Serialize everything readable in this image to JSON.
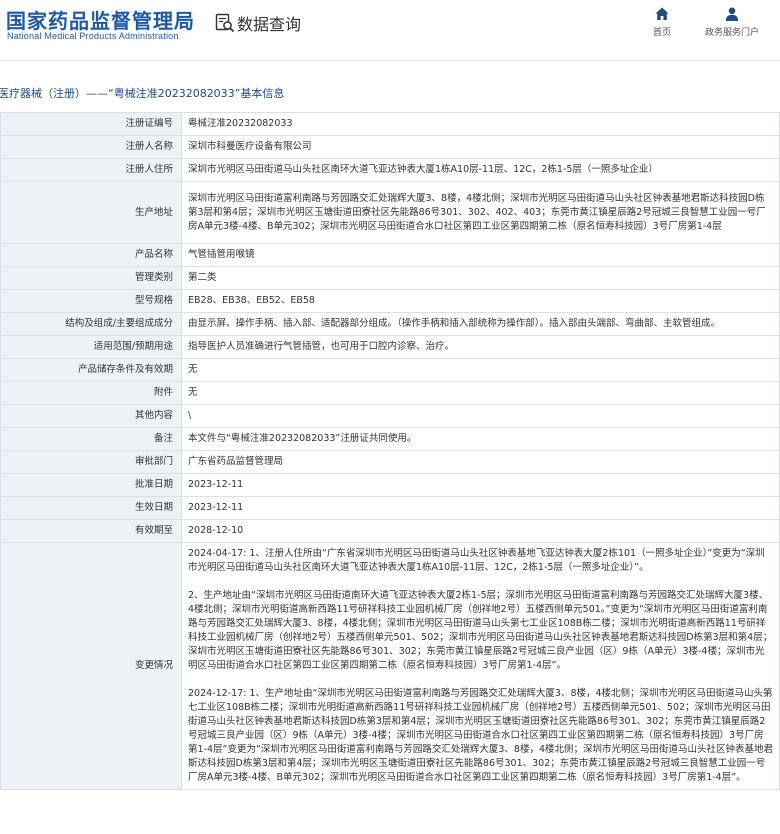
{
  "header": {
    "logo_cn": "国家药品监督管理局",
    "logo_en": "National Medical Products Administration",
    "section_title": "数据查询",
    "nav": [
      {
        "label": "首页",
        "icon": "home-icon"
      },
      {
        "label": "政务服务门户",
        "icon": "user-icon"
      }
    ]
  },
  "breadcrumb": "医疗器械（注册）——“粤械注准20232082033”基本信息",
  "rows": [
    {
      "key": "注册证编号",
      "value": "粤械注准20232082033"
    },
    {
      "key": "注册人名称",
      "value": "深圳市科曼医疗设备有限公司"
    },
    {
      "key": "注册人住所",
      "value": "深圳市光明区马田街道马山头社区南环大道飞亚达钟表大厦1栋A10层-11层、12C，2栋1-5层（一照多址企业）"
    },
    {
      "key": "生产地址",
      "value": "深圳市光明区马田街道富利南路与芳园路交汇处瑞辉大厦3、8楼，4楼北侧；深圳市光明区马田街道马山头社区钟表基地君斯达科技园D栋第3层和第4层；深圳市光明区玉塘街道田寮社区先能路86号301、302、402、403；东莞市黄江镇星辰路2号冠城三良智慧工业园一号厂房A单元3楼-4楼、B单元302；深圳市光明区马田街道合水口社区第四工业区第四期第二栋（原名恒寿科技园）3号厂房第1-4层"
    },
    {
      "key": "产品名称",
      "value": "气管插管用喉镜"
    },
    {
      "key": "管理类别",
      "value": "第二类"
    },
    {
      "key": "型号规格",
      "value": "EB28、EB38、EB52、EB58"
    },
    {
      "key": "结构及组成/主要组成成分",
      "value": "由显示屏、操作手柄、插入部、适配器部分组成。（操作手柄和插入部统称为操作部）。插入部由头端部、弯曲部、主软管组成。"
    },
    {
      "key": "适用范围/预期用途",
      "value": "指导医护人员准确进行气管插管，也可用于口腔内诊察、治疗。"
    },
    {
      "key": "产品储存条件及有效期",
      "value": "无"
    },
    {
      "key": "附件",
      "value": "无"
    },
    {
      "key": "其他内容",
      "value": "\\"
    },
    {
      "key": "备注",
      "value": "本文件与“粤械注准20232082033”注册证共同使用。"
    },
    {
      "key": "审批部门",
      "value": "广东省药品监督管理局"
    },
    {
      "key": "批准日期",
      "value": "2023-12-11"
    },
    {
      "key": "生效日期",
      "value": "2023-12-11"
    },
    {
      "key": "有效期至",
      "value": "2028-12-10"
    }
  ],
  "change": {
    "key": "变更情况",
    "paragraphs": [
      "2024-04-17: 1、注册人住所由“广东省深圳市光明区马田街道马山头社区钟表基地飞亚达钟表大厦2栋101（一照多址企业）”变更为“深圳市光明区马田街道马山头社区南环大道飞亚达钟表大厦1栋A10层-11层、12C，2栋1-5层（一照多址企业）”。",
      "2、生产地址由“深圳市光明区马田街道南环大道飞亚达钟表大厦2栋1-5层；深圳市光明区马田街道富利南路与芳园路交汇处瑞辉大厦3楼、4楼北侧；深圳市光明街道高新西路11号研祥科技工业园机械厂房（创祥地2号）五楼西侧单元501。”变更为“深圳市光明区马田街道富利南路与芳园路交汇处瑞辉大厦3、8楼，4楼北侧；深圳市光明区马田街道马山头第七工业区108B栋二楼；深圳市光明街道高新西路11号研祥科技工业园机械厂房（创祥地2号）五楼西侧单元501、502；深圳市光明区马田街道马山头社区钟表基地君斯达科技园D栋第3层和第4层；深圳市光明区玉塘街道田寮社区先能路86号301、302；东莞市黄江镇星辰路2号冠城三良产业园（区）9栋（A单元）3楼-4楼；深圳市光明区马田街道合水口社区第四工业区第四期第二栋（原名恒寿科技园）3号厂房第1-4层”。",
      "2024-12-17: 1、生产地址由“深圳市光明区马田街道富利南路与芳园路交汇处瑞辉大厦3、8楼，4楼北侧；深圳市光明区马田街道马山头第七工业区108B栋二楼；深圳市光明街道高新西路11号研祥科技工业园机械厂房（创祥地2号）五楼西侧单元501、502；深圳市光明区马田街道马山头社区钟表基地君斯达科技园D栋第3层和第4层；深圳市光明区玉塘街道田寮社区先能路86号301、302；东莞市黄江镇星辰路2号冠城三良产业园（区）9栋（A单元）3楼-4楼；深圳市光明区马田街道合水口社区第四工业区第四期第二栋（原名恒寿科技园）3号厂房第1-4层”变更为“深圳市光明区马田街道富利南路与芳园路交汇处瑞辉大厦3、8楼，4楼北侧；深圳市光明区马田街道马山头社区钟表基地君斯达科技园D栋第3层和第4层；深圳市光明区玉塘街道田寮社区先能路86号301、302；东莞市黄江镇星辰路2号冠城三良智慧工业园一号厂房A单元3楼-4楼、B单元302；深圳市光明区马田街道合水口社区第四工业区第四期第二栋（原名恒寿科技园）3号厂房第1-4层”。"
    ]
  },
  "colors": {
    "brand": "#1f5aa6",
    "breadcrumb": "#1f4a85",
    "key_cell_bg": "#eef1f6",
    "border": "#dcdfe6"
  }
}
